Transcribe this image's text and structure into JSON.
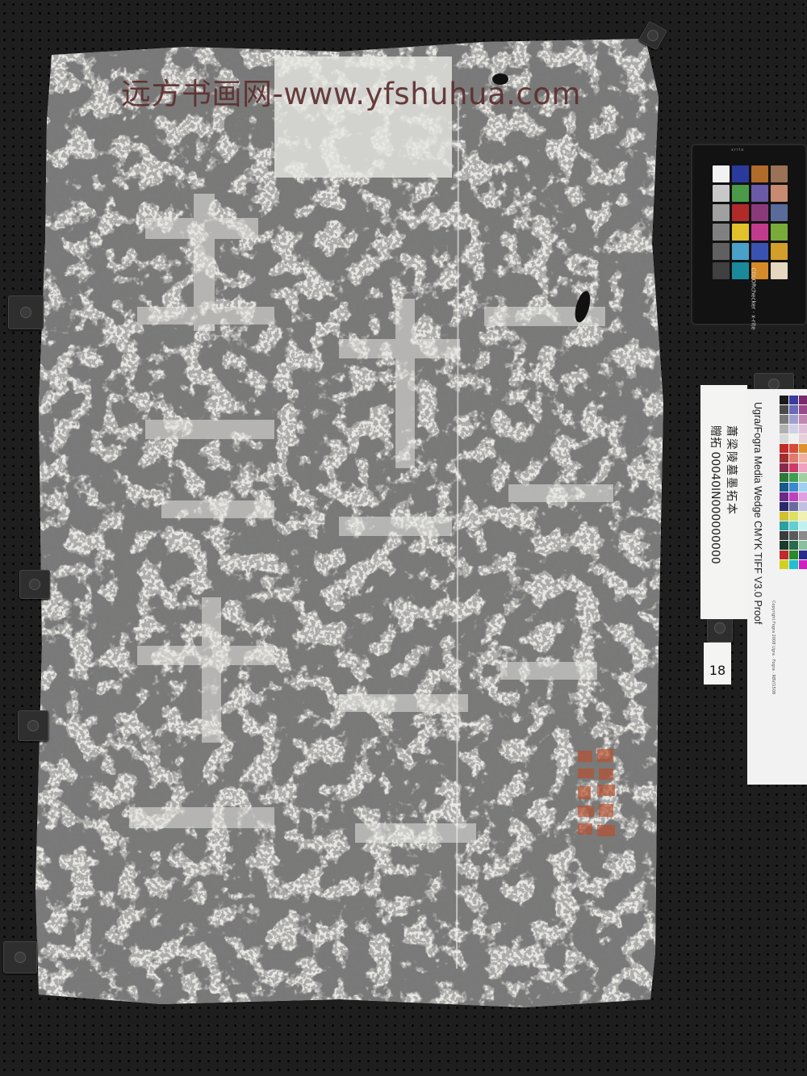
{
  "watermark": {
    "text": "远方书画网-www.yfshuhua.com"
  },
  "label_card": {
    "title": "蕭梁陵墓墨拓本",
    "id_line": "贈拓 00040IN000000000"
  },
  "item_number": "18",
  "color_checker": {
    "brand_top": "xrite",
    "brand": "COLORchecker  ·  x-rite"
  },
  "media_wedge": {
    "title": "Ugra/Fogra Media Wedge CMYK TIFF V3.0 Proof",
    "copyright": "Copyright Fogra 2008   Ugra · Fogra · RBV/1508"
  },
  "seal": {
    "color": "#b8502e"
  },
  "colors": {
    "background": "#1e1e1e",
    "paper": "#e7e6e2",
    "ink": "#2b2b2b",
    "watermark": "#5c2f2f"
  },
  "checker_patches": [
    "#f2f2f2",
    "#2a3a9c",
    "#b06a2a",
    "#9a7256",
    "#c8c8c8",
    "#4a9a4a",
    "#6a5aa8",
    "#c88a70",
    "#a0a0a0",
    "#b02a2a",
    "#8a3a7a",
    "#5a6a9a",
    "#808080",
    "#e2c22a",
    "#c23a8a",
    "#7aaa3a",
    "#606060",
    "#4aa0c8",
    "#3a52b0",
    "#d2a02a",
    "#404040",
    "#1a8a9a",
    "#d68a2a",
    "#e6d8c0"
  ],
  "wedge_patches": [
    "#1a1a1a",
    "#3a3aa0",
    "#7a2a6a",
    "#4a4a4a",
    "#6a6ab8",
    "#9a4a8a",
    "#7a7a7a",
    "#a0a0d0",
    "#c088b0",
    "#b0b0b0",
    "#d0d0e8",
    "#e0c0d8",
    "#d8d8d8",
    "#f0f0f0",
    "#e8d0d8",
    "#c02a2a",
    "#d84a3a",
    "#e0902a",
    "#a03030",
    "#e07a6a",
    "#f0b0a0",
    "#8a2a4a",
    "#d03a6a",
    "#f0a0c0",
    "#2a7a3a",
    "#3aa050",
    "#a0d0a0",
    "#1a5a8a",
    "#3a8ad0",
    "#a0d0f0",
    "#6a2a8a",
    "#c040c0",
    "#e0a0e0",
    "#2a2a6a",
    "#6a6aa0",
    "#c0c0e0",
    "#d0c030",
    "#e0e060",
    "#f0f0b0",
    "#2aa0a0",
    "#60d0d0",
    "#c0f0f0",
    "#3a3a3a",
    "#5a5a5a",
    "#8a8a8a",
    "#1a3a2a",
    "#2a6a4a",
    "#8ac0a0",
    "#c02a2a",
    "#2a8a2a",
    "#2a2a8a",
    "#d0d020",
    "#20c0d0",
    "#d020c0"
  ]
}
